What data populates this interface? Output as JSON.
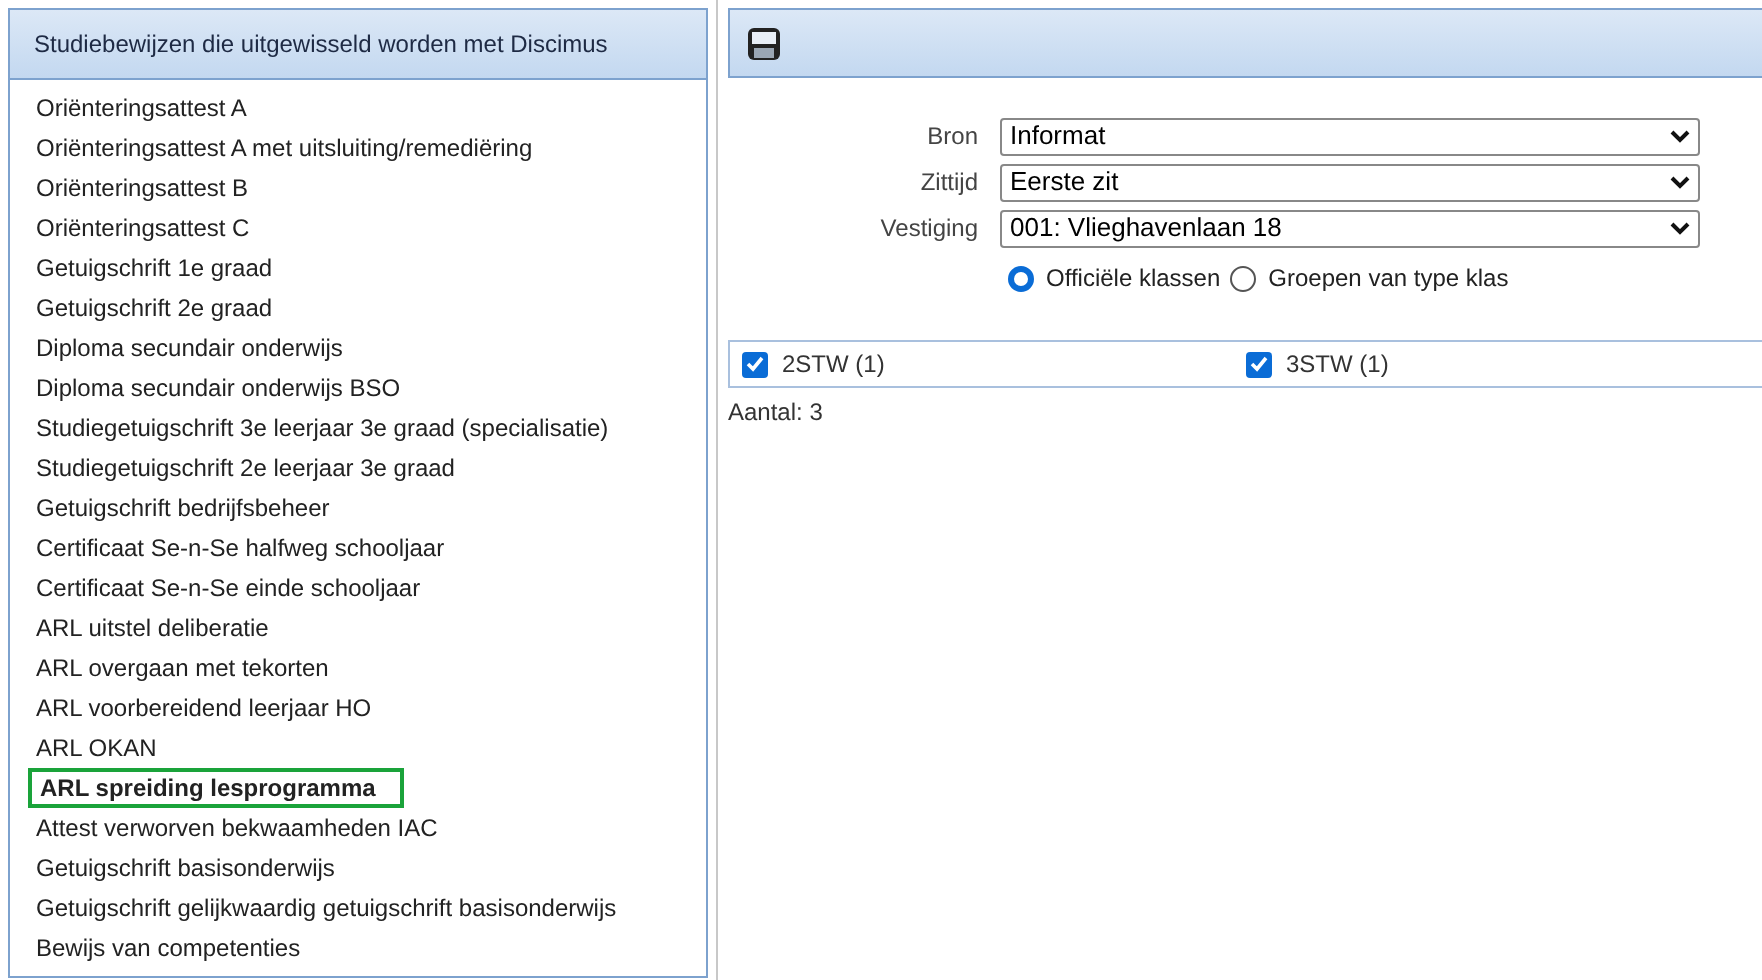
{
  "left_panel": {
    "title": "Studiebewijzen die uitgewisseld worden met Discimus",
    "items": [
      {
        "label": "Oriënteringsattest A",
        "selected": false
      },
      {
        "label": "Oriënteringsattest A met uitsluiting/remediëring",
        "selected": false
      },
      {
        "label": "Oriënteringsattest B",
        "selected": false
      },
      {
        "label": "Oriënteringsattest C",
        "selected": false
      },
      {
        "label": "Getuigschrift 1e graad",
        "selected": false
      },
      {
        "label": "Getuigschrift 2e graad",
        "selected": false
      },
      {
        "label": "Diploma secundair onderwijs",
        "selected": false
      },
      {
        "label": "Diploma secundair onderwijs BSO",
        "selected": false
      },
      {
        "label": "Studiegetuigschrift 3e leerjaar 3e graad (specialisatie)",
        "selected": false
      },
      {
        "label": "Studiegetuigschrift 2e leerjaar 3e graad",
        "selected": false
      },
      {
        "label": "Getuigschrift bedrijfsbeheer",
        "selected": false
      },
      {
        "label": "Certificaat Se-n-Se halfweg schooljaar",
        "selected": false
      },
      {
        "label": "Certificaat Se-n-Se einde schooljaar",
        "selected": false
      },
      {
        "label": "ARL uitstel deliberatie",
        "selected": false
      },
      {
        "label": "ARL overgaan met tekorten",
        "selected": false
      },
      {
        "label": "ARL voorbereidend leerjaar HO",
        "selected": false
      },
      {
        "label": "ARL OKAN",
        "selected": false
      },
      {
        "label": "ARL spreiding lesprogramma",
        "selected": true
      },
      {
        "label": "Attest verworven bekwaamheden IAC",
        "selected": false
      },
      {
        "label": "Getuigschrift basisonderwijs",
        "selected": false
      },
      {
        "label": "Getuigschrift gelijkwaardig getuigschrift basisonderwijs",
        "selected": false
      },
      {
        "label": "Bewijs van competenties",
        "selected": false
      }
    ]
  },
  "right_panel": {
    "fields": [
      {
        "label": "Bron",
        "value": "Informat"
      },
      {
        "label": "Zittijd",
        "value": "Eerste zit"
      },
      {
        "label": "Vestiging",
        "value": "001: Vlieghavenlaan 18"
      }
    ],
    "radios": [
      {
        "label": "Officiële klassen",
        "selected": true
      },
      {
        "label": "Groepen van type klas",
        "selected": false
      }
    ],
    "classes": [
      {
        "label": "2STW (1)",
        "checked": true
      },
      {
        "label": "3STW (1)",
        "checked": true
      }
    ],
    "count": "Aantal: 3"
  }
}
